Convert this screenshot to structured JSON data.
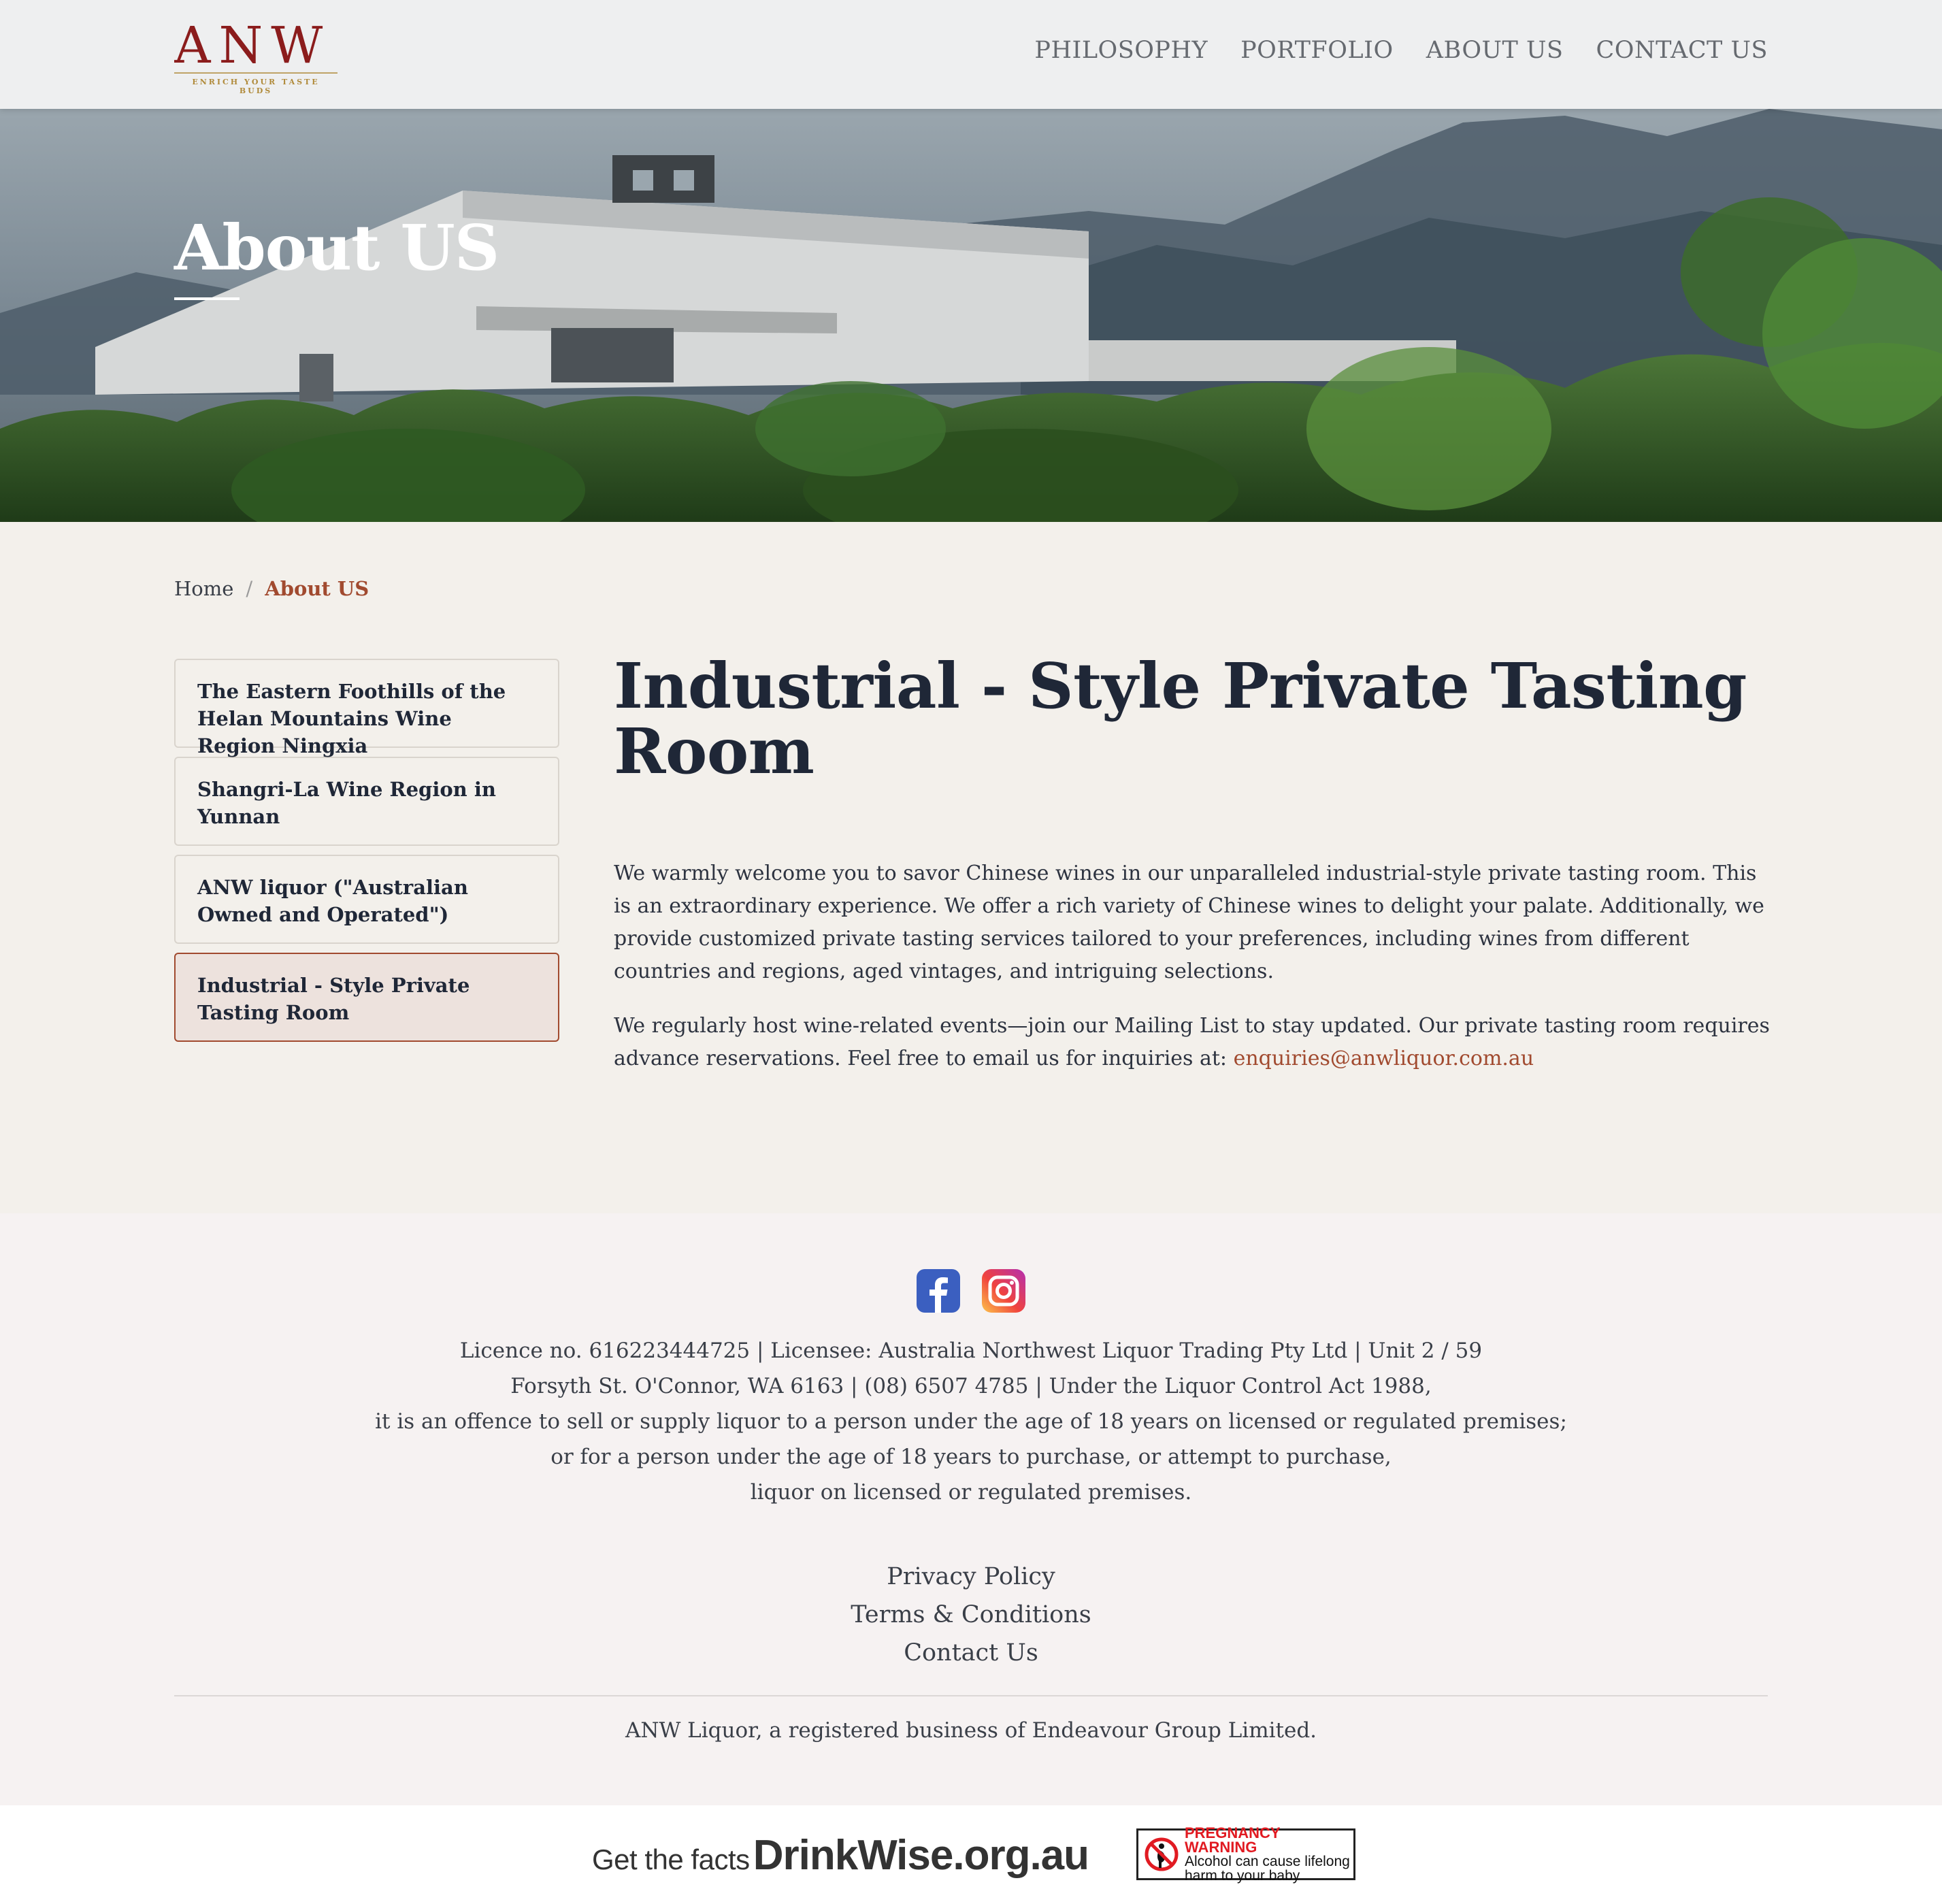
{
  "header": {
    "logo_text": "ANW",
    "logo_tagline": "ENRICH YOUR TASTE BUDS",
    "nav": [
      "PHILOSOPHY",
      "PORTFOLIO",
      "ABOUT US",
      "CONTACT US"
    ]
  },
  "hero": {
    "title": "About US"
  },
  "breadcrumb": {
    "home": "Home",
    "separator": "/",
    "current": "About US"
  },
  "sidebar": {
    "items": [
      "The Eastern Foothills of the Helan Mountains Wine Region Ningxia",
      "Shangri-La Wine Region in Yunnan",
      "ANW liquor (\"Australian Owned and Operated\")",
      "Industrial - Style Private Tasting Room"
    ],
    "active_index": 3
  },
  "main": {
    "heading": "Industrial - Style Private Tasting Room",
    "paragraph1": "We warmly welcome you to savor Chinese wines in our unparalleled industrial-style private tasting room. This is an extraordinary experience. We offer a rich variety of Chinese wines to delight your palate. Additionally, we provide customized private tasting services tailored to your preferences, including wines from different countries and regions, aged vintages, and intriguing selections.",
    "paragraph2_text": "We regularly host wine-related events—join our Mailing List to stay updated. Our private tasting room requires advance reservations. Feel free to email us for inquiries at: ",
    "email": "enquiries@anwliquor.com.au"
  },
  "footer": {
    "social_icons": [
      "facebook-icon",
      "instagram-icon"
    ],
    "legal_lines": [
      "Licence no. 616223444725 | Licensee: Australia Northwest Liquor Trading Pty Ltd | Unit 2 / 59",
      "Forsyth St. O'Connor, WA 6163 | (08) 6507 4785 | Under the Liquor Control Act 1988,",
      "it is an offence to sell or supply liquor to a person under the age of 18 years on licensed or regulated premises;",
      "or for a person under the age of 18 years to purchase, or attempt to purchase,",
      "liquor on licensed or regulated premises."
    ],
    "links": [
      "Privacy Policy",
      "Terms & Conditions",
      "Contact Us"
    ],
    "copyright": "ANW Liquor, a registered business of Endeavour Group Limited."
  },
  "bottom_bar": {
    "drinkwise_prefix": "Get the facts",
    "drinkwise_site": "DrinkWise.org.au",
    "pregnancy_title": "PREGNANCY WARNING",
    "pregnancy_line1": "Alcohol can cause lifelong",
    "pregnancy_line2": "harm to your baby"
  },
  "colors": {
    "brand": "#8b1c1c",
    "accent": "#a14a2f",
    "gold": "#b08a3a",
    "text": "#1f2737",
    "background": "#f3f0eb",
    "footer_bg": "#f6f2f2"
  }
}
